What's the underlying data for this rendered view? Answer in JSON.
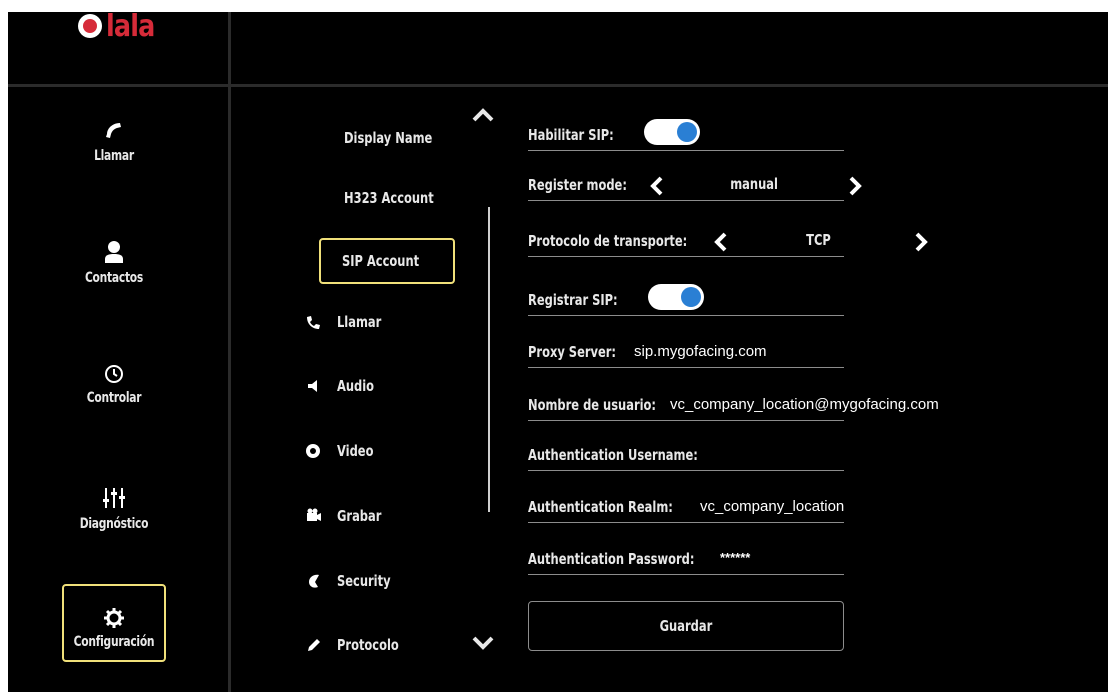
{
  "brand": {
    "logo_text": "lala"
  },
  "nav": {
    "items": [
      {
        "label": "Llamar",
        "icon": "phone-icon"
      },
      {
        "label": "Contactos",
        "icon": "person-icon"
      },
      {
        "label": "Controlar",
        "icon": "clock-icon"
      },
      {
        "label": "Diagnóstico",
        "icon": "sliders-icon"
      },
      {
        "label": "Configuración",
        "icon": "gear-icon",
        "active": true
      }
    ]
  },
  "submenu": {
    "items": [
      {
        "label": "Display Name"
      },
      {
        "label": "H323 Account"
      },
      {
        "label": "SIP Account",
        "active": true
      },
      {
        "label": "Llamar",
        "icon": "phone-icon"
      },
      {
        "label": "Audio",
        "icon": "speaker-icon"
      },
      {
        "label": "Video",
        "icon": "camera-icon"
      },
      {
        "label": "Grabar",
        "icon": "record-icon"
      },
      {
        "label": "Security",
        "icon": "shield-icon"
      },
      {
        "label": "Protocolo",
        "icon": "pencil-icon"
      }
    ]
  },
  "form": {
    "enable_sip": {
      "label": "Habilitar SIP:",
      "on": true
    },
    "register_mode": {
      "label": "Register mode:",
      "value": "manual"
    },
    "transport": {
      "label": "Protocolo de transporte:",
      "value": "TCP"
    },
    "register_sip": {
      "label": "Registrar SIP:",
      "on": true
    },
    "proxy": {
      "label": "Proxy Server:",
      "value": "sip.mygofacing.com"
    },
    "username": {
      "label": "Nombre de usuario:",
      "value": "vc_company_location@mygofacing.com"
    },
    "auth_username": {
      "label": "Authentication Username:",
      "value": ""
    },
    "auth_realm": {
      "label": "Authentication Realm:",
      "value": "vc_company_location"
    },
    "auth_password": {
      "label": "Authentication Password:",
      "value": "******"
    },
    "save_label": "Guardar"
  },
  "colors": {
    "accent_border": "#f0e07a",
    "toggle_knob": "#2a7fd4",
    "brand_red": "#d62b39"
  }
}
